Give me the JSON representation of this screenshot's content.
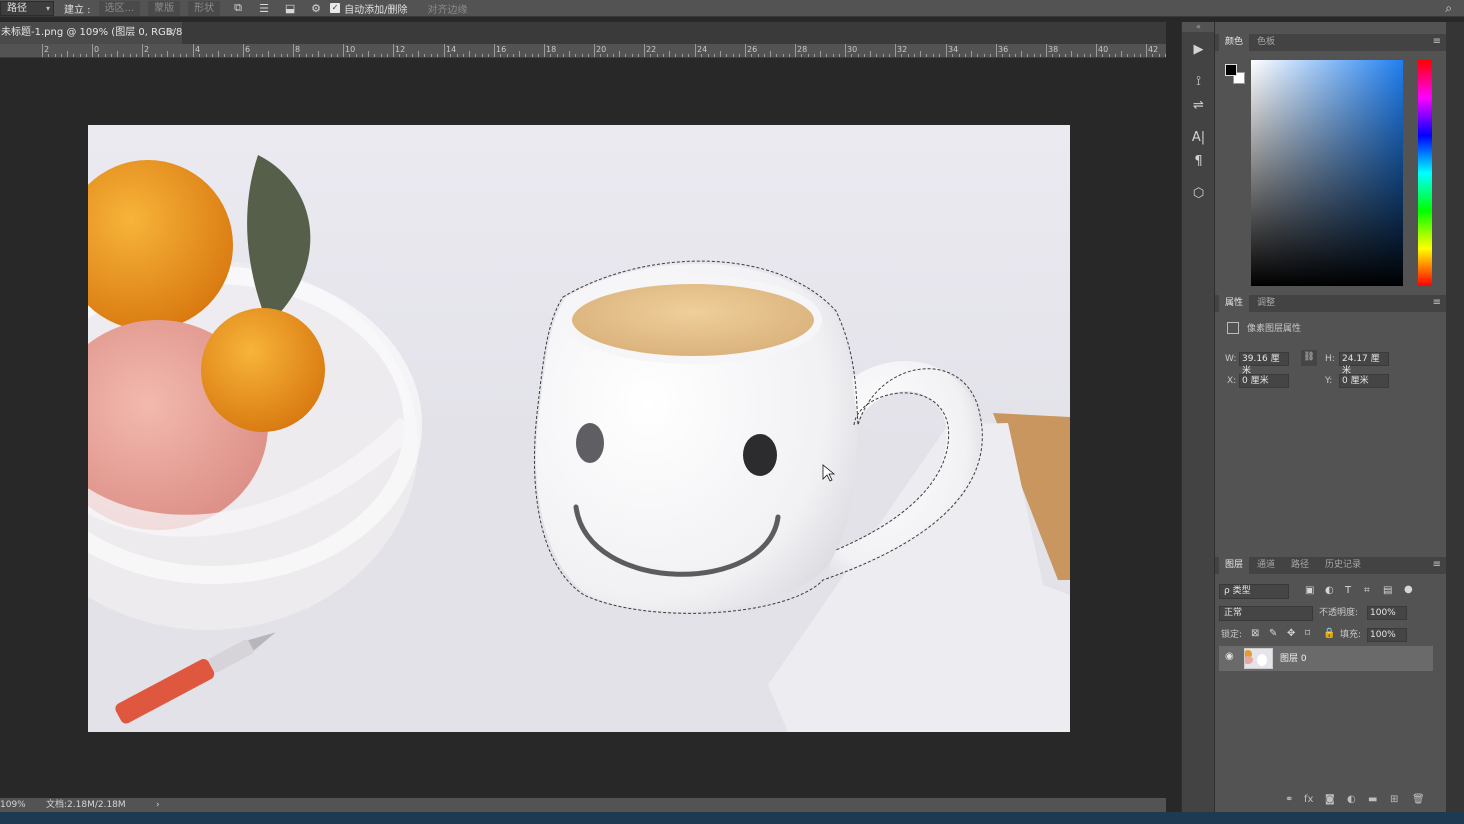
{
  "options_bar": {
    "mode_select": "路径",
    "build_label": "建立 :",
    "btn_selection": "选区...",
    "btn_mask": "蒙版",
    "btn_shape": "形状",
    "auto_add_label": "自动添加/删除",
    "align_edges_label": "对齐边缘"
  },
  "document": {
    "tab_title": "未标题-1.png @ 109% (图层 0, RGB/8) *",
    "close": "×"
  },
  "ruler": {
    "labels": [
      "2",
      "0",
      "2",
      "4",
      "6",
      "8",
      "10",
      "12",
      "14",
      "16",
      "18",
      "20",
      "22",
      "24",
      "26",
      "28",
      "30",
      "32",
      "34",
      "36",
      "38",
      "40",
      "42"
    ]
  },
  "status": {
    "zoom": "109%",
    "doc_size": "文档:2.18M/2.18M",
    "arrow": "›"
  },
  "panels": {
    "color": {
      "tabs": [
        "颜色",
        "色板"
      ],
      "active": 0,
      "foreground": "#000000",
      "background": "#ffffff"
    },
    "properties": {
      "tabs": [
        "属性",
        "调整"
      ],
      "active": 0,
      "title": "像素图层属性",
      "w_label": "W:",
      "w_value": "39.16 厘米",
      "h_label": "H:",
      "h_value": "24.17 厘米",
      "x_label": "X:",
      "x_value": "0 厘米",
      "y_label": "Y:",
      "y_value": "0 厘米"
    },
    "layers": {
      "tabs": [
        "图层",
        "通道",
        "路径",
        "历史记录"
      ],
      "active": 0,
      "filter_kind": "ρ 类型",
      "blend_mode": "正常",
      "opacity_label": "不透明度:",
      "opacity_value": "100%",
      "lock_label": "锁定:",
      "fill_label": "填充:",
      "fill_value": "100%",
      "layer_name": "图层 0"
    }
  },
  "icons": {
    "menu": "≡",
    "eye": "👁",
    "link": "⛓",
    "caret": "⌄",
    "search": "⌕",
    "play": "▶",
    "type": "A|",
    "paragraph": "¶",
    "cube": "⬡"
  },
  "colors": {
    "ui_dark": "#282828",
    "ui_mid": "#535353",
    "panel": "#434343",
    "accent": "#1d3a52"
  }
}
